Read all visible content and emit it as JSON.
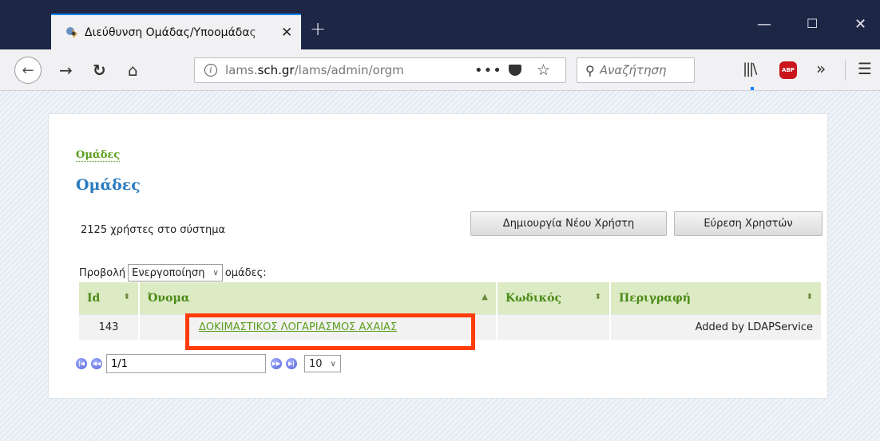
{
  "browser": {
    "tab_title": "Διεύθυνση Ομάδας/Υποομάδας",
    "url_host_prefix": "lams.",
    "url_host_main": "sch.gr",
    "url_path": "/lams/admin/orgm",
    "search_placeholder": "Αναζήτηση",
    "abp_label": "ABP"
  },
  "page": {
    "breadcrumb": "Ομάδες",
    "title": "Ομάδες",
    "users_count": "2125 χρήστες στο σύστημα",
    "create_user_button": "Δημιουργία Νέου Χρήστη",
    "find_users_button": "Εύρεση Χρηστών",
    "view_label": "Προβολή",
    "view_selected": "Ενεργοποίηση",
    "view_suffix": "ομάδες:"
  },
  "table": {
    "headers": {
      "id": "Id",
      "name": "Όνομα",
      "code": "Κωδικός",
      "description": "Περιγραφή"
    },
    "rows": [
      {
        "id": "143",
        "name": "ΔΟΚΙΜΑΣΤΙΚΟΣ ΛΟΓΑΡΙΑΣΜΟΣ ΑΧΑΙΑΣ",
        "code": "",
        "description": "Added by LDAPService"
      }
    ]
  },
  "pager": {
    "page_value": "1/1",
    "page_size": "10"
  },
  "colors": {
    "accent_green": "#5c9f1f",
    "title_blue": "#2b7cc0",
    "highlight_red": "#ff3c0a",
    "header_bg": "#dcebc4"
  }
}
